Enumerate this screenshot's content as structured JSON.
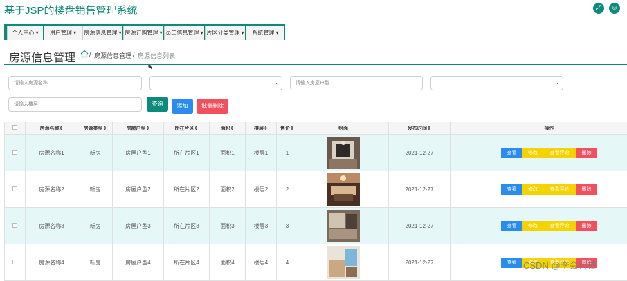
{
  "app": {
    "title": "基于JSP的楼盘销售管理系统"
  },
  "top_icons": [
    {
      "name": "expand-icon",
      "glyph": "⤢"
    },
    {
      "name": "user-icon",
      "glyph": "☺"
    }
  ],
  "nav": [
    {
      "label": "个人中心"
    },
    {
      "label": "用户管理"
    },
    {
      "label": "房源信息管理"
    },
    {
      "label": "房源订购管理"
    },
    {
      "label": "员工信息管理"
    },
    {
      "label": "片区分类管理"
    },
    {
      "label": "系统管理"
    }
  ],
  "page": {
    "title": "房源信息管理",
    "crumb_1": "房源信息管理",
    "crumb_sep": "/",
    "crumb_2": "房源信息列表"
  },
  "search": {
    "name_placeholder": "请输入房源名称",
    "layout_placeholder": "请输入房屋户型",
    "floor_placeholder": "请输入楼层"
  },
  "buttons": {
    "query": "查询",
    "add": "添加",
    "batch_delete": "批量删除"
  },
  "table": {
    "headers": [
      "",
      "房源名称",
      "房源类型",
      "房屋户型",
      "所在片区",
      "面积",
      "楼层",
      "售价",
      "封面",
      "发布时间",
      "操作"
    ],
    "rows": [
      {
        "name": "房源名称1",
        "type": "新房",
        "layout": "房屋户型1",
        "area": "所在片区1",
        "size": "面积1",
        "floor": "楼层1",
        "price": "1",
        "date": "2021-12-27"
      },
      {
        "name": "房源名称2",
        "type": "新房",
        "layout": "房屋户型2",
        "area": "所在片区2",
        "size": "面积2",
        "floor": "楼层2",
        "price": "2",
        "date": "2021-12-27"
      },
      {
        "name": "房源名称3",
        "type": "新房",
        "layout": "房屋户型3",
        "area": "所在片区3",
        "size": "面积3",
        "floor": "楼层3",
        "price": "3",
        "date": "2021-12-27"
      },
      {
        "name": "房源名称4",
        "type": "新房",
        "layout": "房屋户型4",
        "area": "所在片区4",
        "size": "面积4",
        "floor": "楼层4",
        "price": "4",
        "date": "2021-12-27"
      }
    ],
    "ops": {
      "view": "查看",
      "edit": "修改",
      "comments": "查看评论",
      "delete": "删除"
    }
  },
  "colors": {
    "brand": "#0c8a7c",
    "add": "#2b8cf0",
    "danger": "#f2505e",
    "warn": "#f5d300",
    "row_alt": "#e6f7f7"
  },
  "watermark": "CSDN @李会科技"
}
